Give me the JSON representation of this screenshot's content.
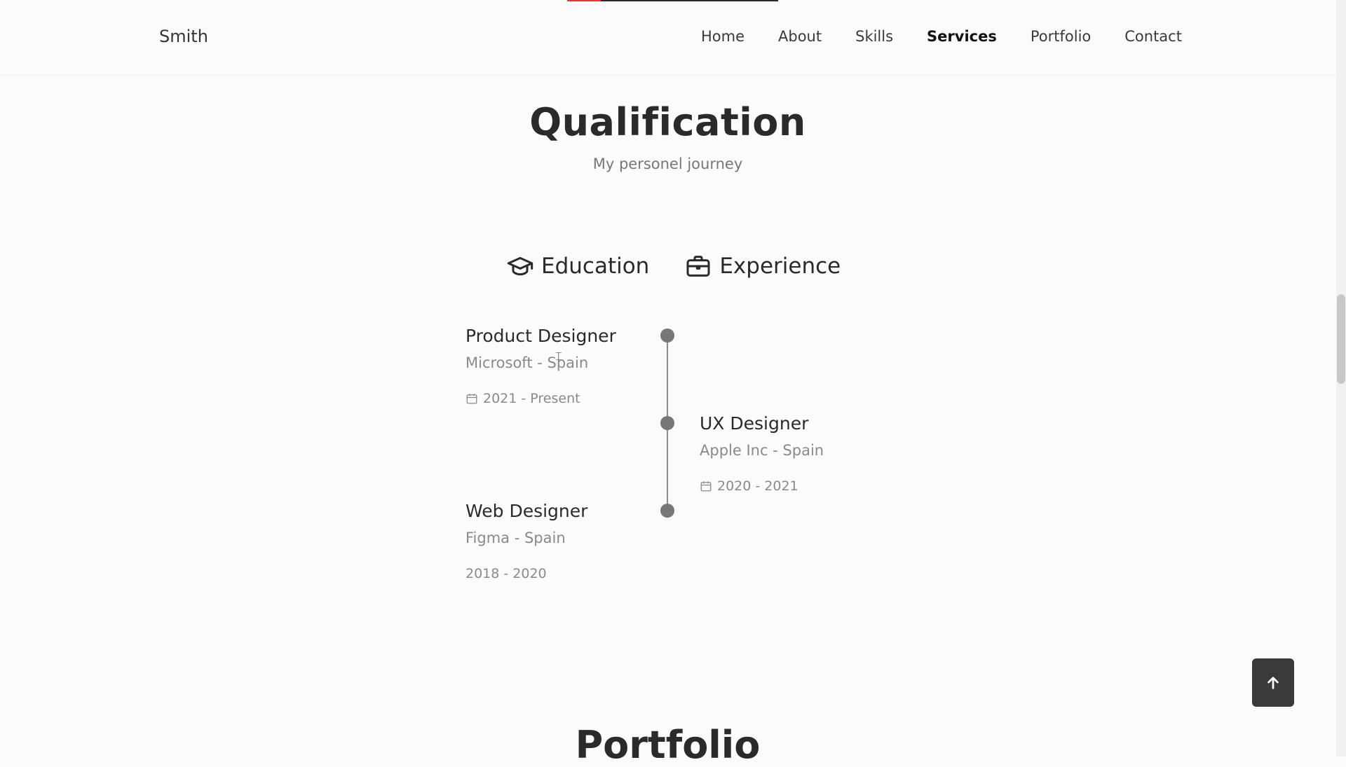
{
  "header": {
    "logo": "Smith",
    "nav": [
      {
        "label": "Home"
      },
      {
        "label": "About"
      },
      {
        "label": "Skills"
      },
      {
        "label": "Services",
        "active": true
      },
      {
        "label": "Portfolio"
      },
      {
        "label": "Contact"
      }
    ],
    "scroll_progress_percent": 16
  },
  "qualification": {
    "title": "Qualification",
    "subtitle": "My personel journey",
    "tabs": [
      {
        "label": "Education",
        "icon": "graduation-cap-icon"
      },
      {
        "label": "Experience",
        "icon": "briefcase-icon"
      }
    ],
    "entries": [
      {
        "title": "Product Designer",
        "org": "Microsoft - Spain",
        "date": "2021 - Present",
        "side": "left",
        "has_calendar_icon": true
      },
      {
        "title": "UX Designer",
        "org": "Apple Inc - Spain",
        "date": "2020 - 2021",
        "side": "right",
        "has_calendar_icon": true
      },
      {
        "title": "Web Designer",
        "org": "Figma - Spain",
        "date": "2018 - 2020",
        "side": "left",
        "has_calendar_icon": false
      }
    ]
  },
  "portfolio": {
    "title": "Portfolio"
  },
  "colors": {
    "background": "#fbfbfb",
    "text": "#2a2a2a",
    "muted": "#8a8a8a",
    "progress_fill": "#e53935",
    "button": "#3a3a3a"
  }
}
